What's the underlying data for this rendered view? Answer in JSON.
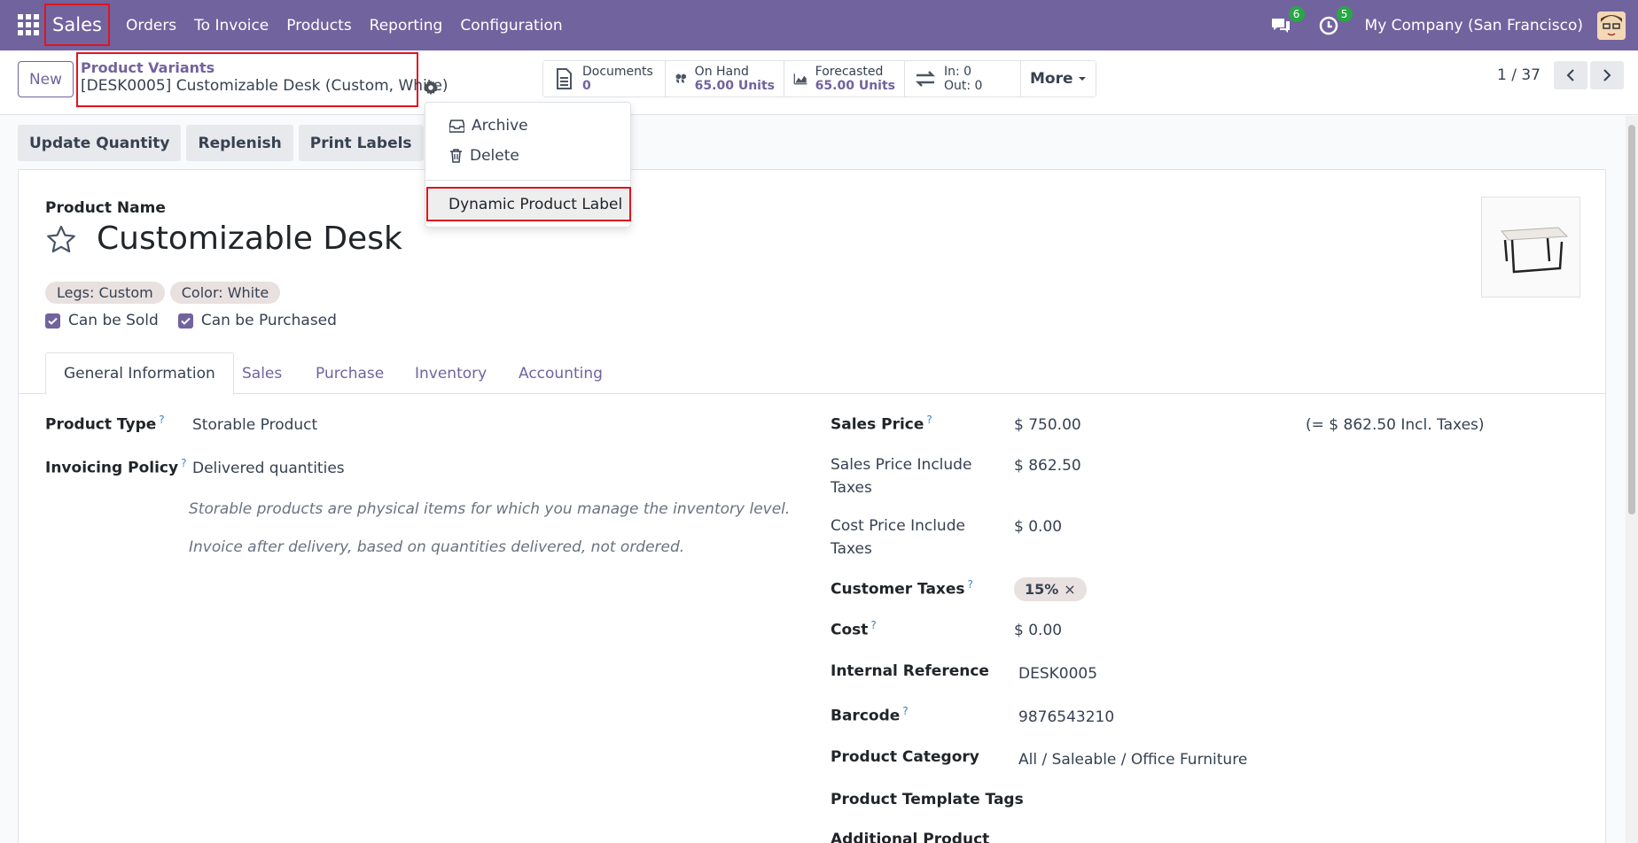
{
  "navbar": {
    "brand": "Sales",
    "menu": [
      "Orders",
      "To Invoice",
      "Products",
      "Reporting",
      "Configuration"
    ],
    "messages_count": "6",
    "activities_count": "5",
    "company": "My Company (San Francisco)"
  },
  "control_panel": {
    "new_label": "New",
    "breadcrumb_parent": "Product Variants",
    "breadcrumb_current": "[DESK0005] Customizable Desk (Custom, White)",
    "smart_buttons": {
      "documents": {
        "label": "Documents",
        "value": "0"
      },
      "on_hand": {
        "label": "On Hand",
        "value": "65.00 Units"
      },
      "forecasted": {
        "label": "Forecasted",
        "value": "65.00 Units"
      },
      "in_out": {
        "in": "In: 0",
        "out": "Out: 0"
      },
      "more": "More"
    },
    "pager": "1 / 37"
  },
  "actions": {
    "update_quantity": "Update Quantity",
    "replenish": "Replenish",
    "print_labels": "Print Labels"
  },
  "gear_menu": {
    "archive": "Archive",
    "delete": "Delete",
    "dynamic_label": "Dynamic Product Label"
  },
  "form": {
    "product_name_label": "Product Name",
    "product_name": "Customizable Desk",
    "tags": [
      "Legs: Custom",
      "Color: White"
    ],
    "can_be_sold": "Can be Sold",
    "can_be_purchased": "Can be Purchased",
    "tabs": [
      "General Information",
      "Sales",
      "Purchase",
      "Inventory",
      "Accounting"
    ],
    "left": {
      "product_type_label": "Product Type",
      "product_type": "Storable Product",
      "invoicing_policy_label": "Invoicing Policy",
      "invoicing_policy": "Delivered quantities",
      "note1": "Storable products are physical items for which you manage the inventory level.",
      "note2": "Invoice after delivery, based on quantities delivered, not ordered."
    },
    "right": {
      "sales_price_label": "Sales Price",
      "sales_price": "$ 750.00",
      "sales_price_incl": "(= $ 862.50 Incl. Taxes)",
      "sales_price_include_taxes_label": "Sales Price Include Taxes",
      "sales_price_include_taxes": "$ 862.50",
      "cost_price_include_taxes_label": "Cost Price Include Taxes",
      "cost_price_include_taxes": "$ 0.00",
      "customer_taxes_label": "Customer Taxes",
      "customer_taxes_tag": "15%",
      "cost_label": "Cost",
      "cost": "$ 0.00",
      "internal_reference_label": "Internal Reference",
      "internal_reference": "DESK0005",
      "barcode_label": "Barcode",
      "barcode": "9876543210",
      "product_category_label": "Product Category",
      "product_category": "All / Saleable / Office Furniture",
      "product_template_tags_label": "Product Template Tags",
      "additional_product_label": "Additional Product"
    }
  },
  "colors": {
    "primary": "#71639e",
    "highlight_border": "#e0141e",
    "badge": "#28a745"
  }
}
